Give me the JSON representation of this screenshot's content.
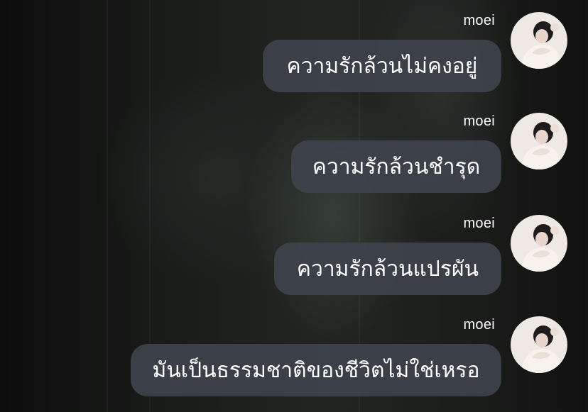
{
  "chat": {
    "messages": [
      {
        "sender": "moei",
        "text": "ความรักล้วนไม่คงอยู่"
      },
      {
        "sender": "moei",
        "text": "ความรักล้วนชำรุด"
      },
      {
        "sender": "moei",
        "text": "ความรักล้วนแปรผัน"
      },
      {
        "sender": "moei",
        "text": "มันเป็นธรรมชาติของชีวิตไม่ใช่เหรอ"
      }
    ]
  },
  "colors": {
    "bubble": "#3e434c",
    "text": "#ffffff",
    "background": "#141614"
  }
}
